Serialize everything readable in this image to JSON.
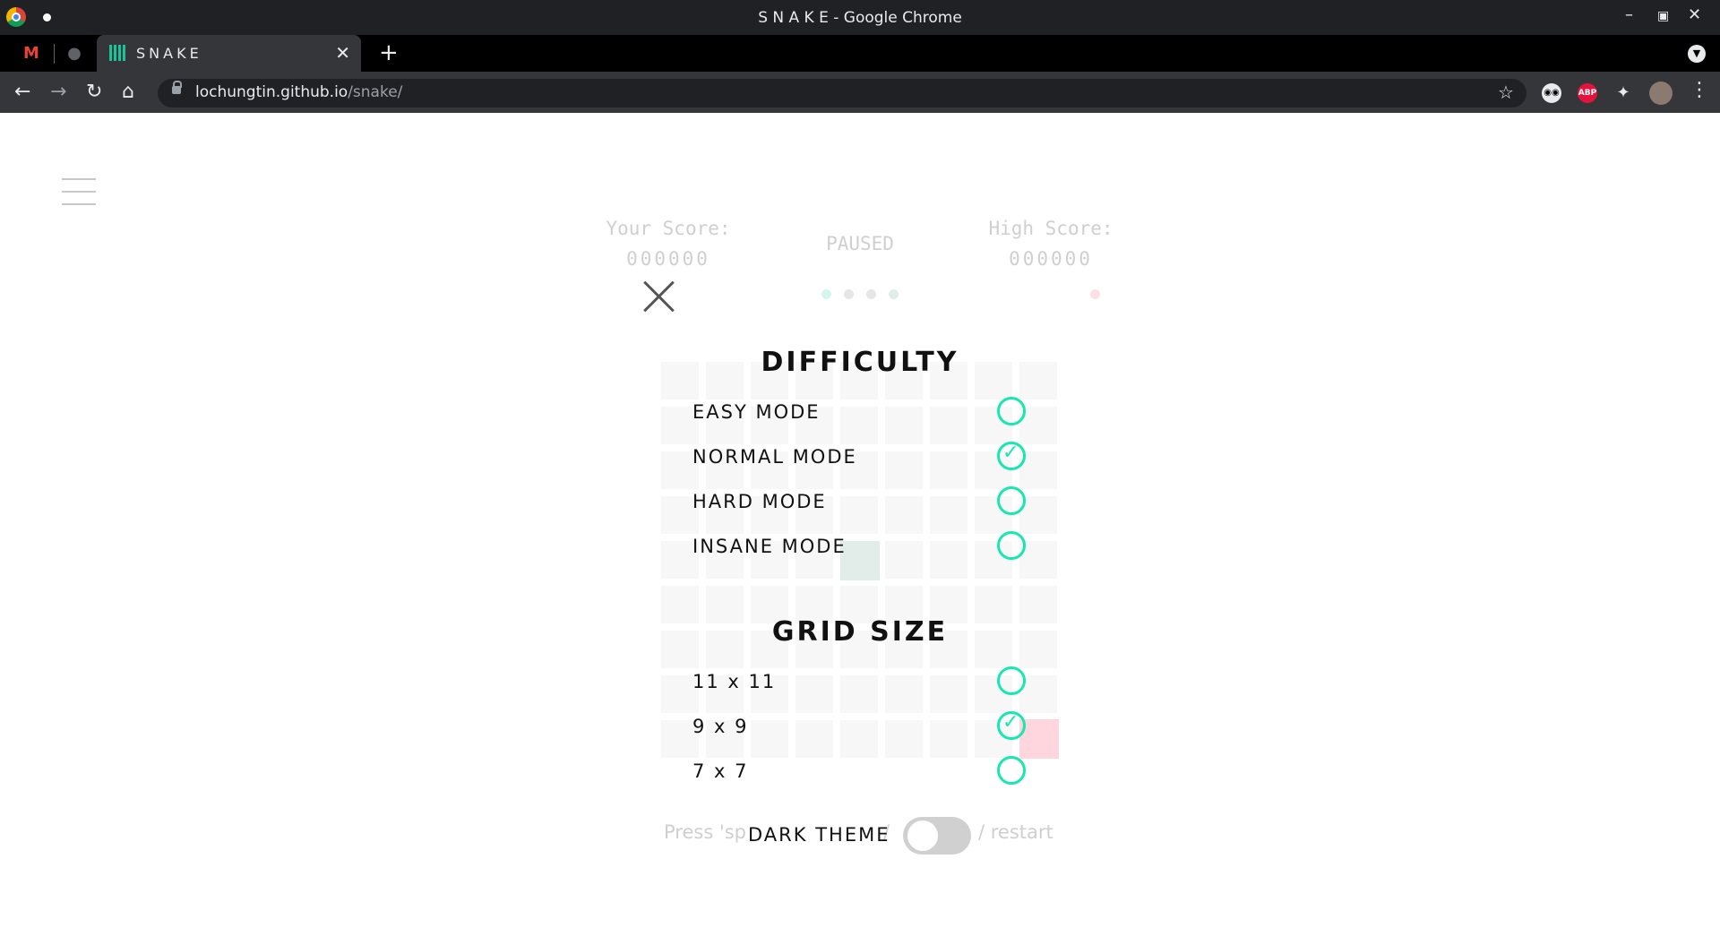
{
  "window": {
    "title": "S N A K E - Google Chrome"
  },
  "tabs": [
    {
      "icon": "gmail-icon"
    },
    {
      "icon": "github-icon"
    },
    {
      "label": "SNAKE",
      "active": true
    }
  ],
  "address_bar": {
    "host": "lochungtin.github.io",
    "path": "/snake/"
  },
  "scoreboard": {
    "your_score_label": "Your Score:",
    "your_score_value": "000000",
    "status": "PAUSED",
    "high_score_label": "High Score:",
    "high_score_value": "000000"
  },
  "settings": {
    "difficulty_title": "DIFFICULTY",
    "difficulty_options": [
      {
        "label": "EASY MODE",
        "selected": false
      },
      {
        "label": "NORMAL MODE",
        "selected": true
      },
      {
        "label": "HARD MODE",
        "selected": false
      },
      {
        "label": "INSANE MODE",
        "selected": false
      }
    ],
    "grid_title": "GRID SIZE",
    "grid_options": [
      {
        "label": "11 x 11",
        "selected": false
      },
      {
        "label": "9 x 9",
        "selected": true
      },
      {
        "label": "7 x 7",
        "selected": false
      }
    ],
    "dark_theme_label": "DARK THEME",
    "dark_theme_on": false
  },
  "footer_hint": {
    "left": "Press 'sp",
    "middle": "/",
    "right": "/ restart"
  },
  "colors": {
    "accent": "#17e8b0",
    "food": "#ffd6de",
    "snake": "#e2ece9"
  }
}
